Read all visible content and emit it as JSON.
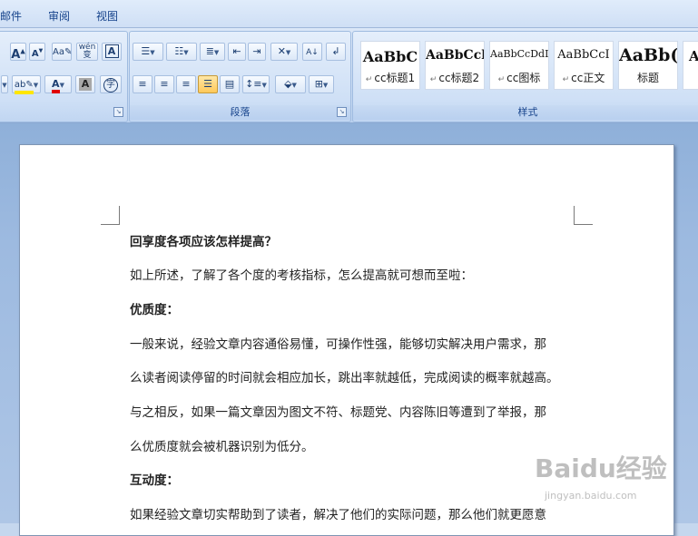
{
  "tabs": [
    "邮件",
    "审阅",
    "视图"
  ],
  "ribbon": {
    "font_buttons_row1": [
      {
        "name": "grow-font",
        "glyph": "A",
        "sup": "+"
      },
      {
        "name": "shrink-font",
        "glyph": "A",
        "sup": "-"
      },
      {
        "name": "clear-format",
        "glyph": "Aa"
      },
      {
        "name": "phonetic-guide",
        "glyph": "wén 变"
      },
      {
        "name": "char-border",
        "glyph": "A"
      }
    ],
    "font_buttons_row2": [
      {
        "name": "highlight",
        "glyph": "ab"
      },
      {
        "name": "font-color",
        "glyph": "A"
      },
      {
        "name": "char-shading",
        "glyph": "A"
      },
      {
        "name": "enclose-char",
        "glyph": "字"
      }
    ],
    "paragraph_group_label": "段落",
    "styles_group_label": "样式",
    "styles": [
      {
        "sample": "AaBbC",
        "name": "cc标题1"
      },
      {
        "sample": "AaBbCcl",
        "name": "cc标题2"
      },
      {
        "sample": "AaBbCcDdI",
        "name": "cc图标"
      },
      {
        "sample": "AaBbCcI",
        "name": "cc正文"
      },
      {
        "sample": "AaBb(",
        "name": "标题"
      },
      {
        "sample": "A",
        "name": ""
      }
    ],
    "colors": {
      "highlight": "#ffe600",
      "font_color": "#e00000"
    }
  },
  "document": {
    "paragraphs": [
      {
        "text": "回享度各项应该怎样提高？",
        "bold": true
      },
      {
        "text": "如上所述，了解了各个度的考核指标，怎么提高就可想而至啦：",
        "bold": false
      },
      {
        "text": "优质度：",
        "bold": true
      },
      {
        "text": "一般来说，经验文章内容通俗易懂，可操作性强，能够切实解决用户需求，那",
        "bold": false
      },
      {
        "text": "么读者阅读停留的时间就会相应加长，跳出率就越低，完成阅读的概率就越高。",
        "bold": false
      },
      {
        "text": "与之相反，如果一篇文章因为图文不符、标题党、内容陈旧等遭到了举报，那",
        "bold": false
      },
      {
        "text": "么优质度就会被机器识别为低分。",
        "bold": false
      },
      {
        "text": "互动度：",
        "bold": true
      },
      {
        "text": "如果经验文章切实帮助到了读者，解决了他们的实际问题，那么他们就更愿意",
        "bold": false
      }
    ]
  },
  "watermark": {
    "logo": "Baidu经验",
    "url": "jingyan.baidu.com"
  }
}
